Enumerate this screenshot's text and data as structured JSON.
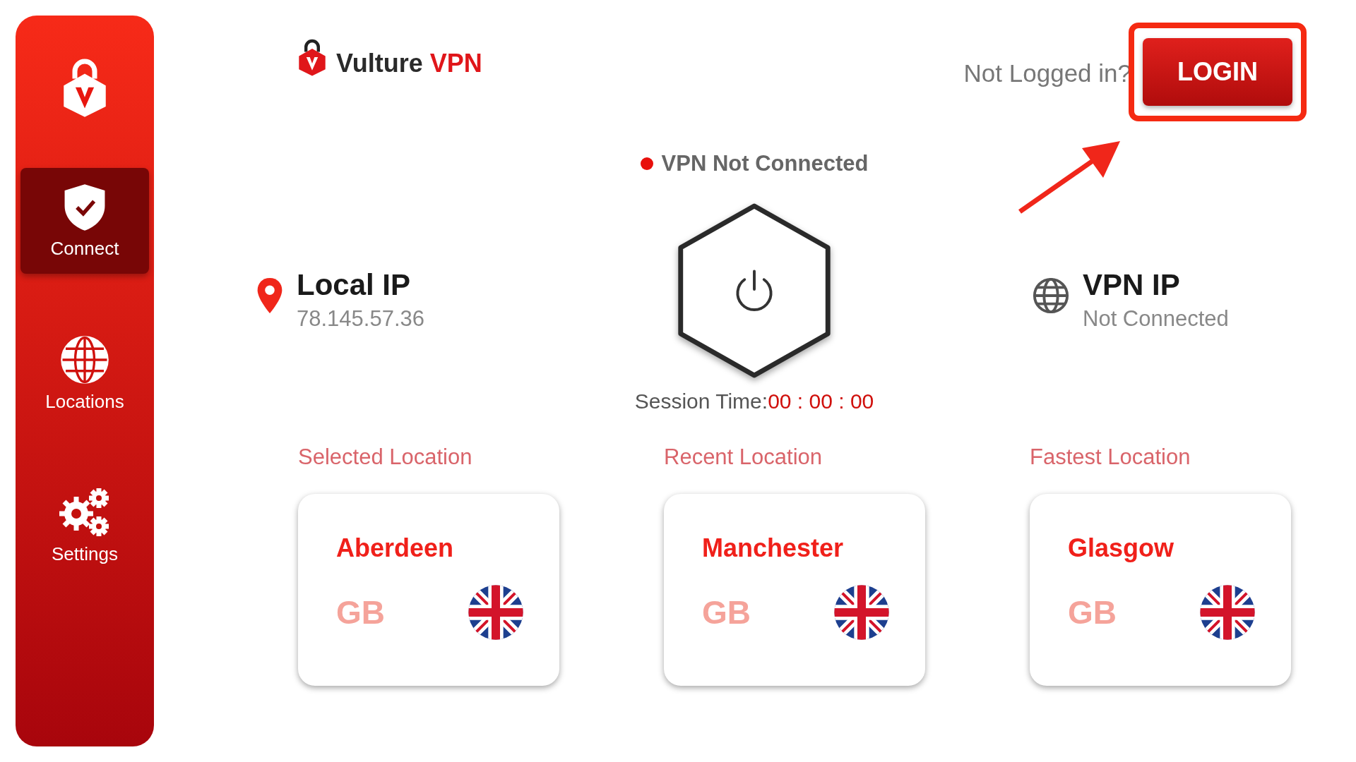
{
  "sidebar": {
    "items": [
      {
        "kind": "shield",
        "label": "Connect",
        "selected": true
      },
      {
        "kind": "globe",
        "label": "Locations",
        "selected": false
      },
      {
        "kind": "gears",
        "label": "Settings",
        "selected": false
      }
    ]
  },
  "header": {
    "brand": "Vulture",
    "brand_accent": "VPN",
    "login_prompt": "Not Logged in?",
    "login_button": "LOGIN"
  },
  "status": {
    "text": "VPN Not Connected",
    "connected": false
  },
  "local_ip": {
    "label": "Local IP",
    "value": "78.145.57.36"
  },
  "vpn_ip": {
    "label": "VPN IP",
    "value": "Not Connected"
  },
  "session": {
    "label": "Session Time:",
    "value": "00 : 00 : 00"
  },
  "locations": [
    {
      "heading": "Selected Location",
      "city": "Aberdeen",
      "country": "GB"
    },
    {
      "heading": "Recent Location",
      "city": "Manchester",
      "country": "GB"
    },
    {
      "heading": "Fastest Location",
      "city": "Glasgow",
      "country": "GB"
    }
  ]
}
